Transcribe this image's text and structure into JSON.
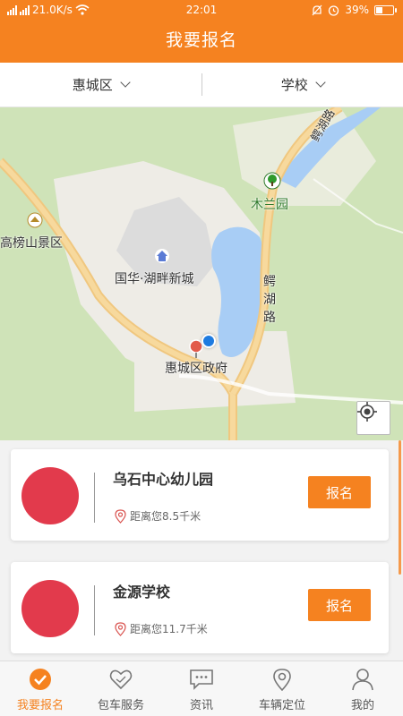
{
  "status_bar": {
    "network_speed": "21.0K/s",
    "time": "22:01",
    "battery": "39%",
    "battery_level": 0.39
  },
  "header": {
    "title": "我要报名"
  },
  "filters": [
    {
      "label": "惠城区"
    },
    {
      "label": "学校"
    }
  ],
  "map": {
    "labels": {
      "park": "木兰园",
      "scenic": "高榜山景区",
      "community": "国华·湖畔新城",
      "government": "惠城区政府",
      "road1": "鳄",
      "road2": "湖",
      "road3": "路",
      "road_top": "鳄湖路"
    }
  },
  "schools": [
    {
      "name": "乌石中心幼儿园",
      "distance": "距离您8.5千米",
      "button": "报名"
    },
    {
      "name": "金源学校",
      "distance": "距离您11.7千米",
      "button": "报名"
    }
  ],
  "nav": [
    {
      "label": "我要报名",
      "icon": "check-circle-icon",
      "active": true
    },
    {
      "label": "包车服务",
      "icon": "heart-icon",
      "active": false
    },
    {
      "label": "资讯",
      "icon": "chat-icon",
      "active": false
    },
    {
      "label": "车辆定位",
      "icon": "location-pin-icon",
      "active": false
    },
    {
      "label": "我的",
      "icon": "user-icon",
      "active": false
    }
  ],
  "colors": {
    "accent": "#f58220",
    "avatar": "#e23a4c",
    "map_green": "#cfe3b8",
    "water": "#a8cdf5"
  }
}
